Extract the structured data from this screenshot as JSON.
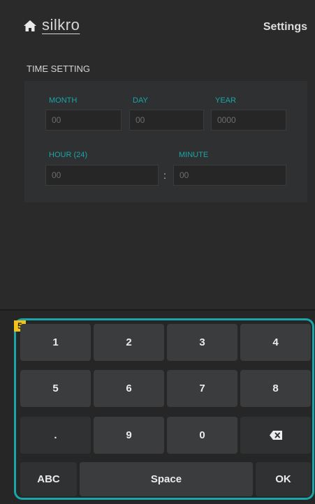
{
  "header": {
    "home_icon": "home-icon",
    "logo": "silkro",
    "settings_label": "Settings"
  },
  "time_setting": {
    "title": "TIME SETTING",
    "month": {
      "label": "MONTH",
      "placeholder": "00"
    },
    "day": {
      "label": "DAY",
      "placeholder": "00"
    },
    "year": {
      "label": "YEAR",
      "placeholder": "0000"
    },
    "hour": {
      "label": "HOUR (24)",
      "placeholder": "00"
    },
    "minute": {
      "label": "MINUTE",
      "placeholder": "00"
    },
    "separator": ":"
  },
  "keyboard": {
    "badge": "5",
    "keys": {
      "k1": "1",
      "k2": "2",
      "k3": "3",
      "k4": "4",
      "k5": "5",
      "k6": "6",
      "k7": "7",
      "k8": "8",
      "dot": ".",
      "k9": "9",
      "k0": "0",
      "backspace_icon": "backspace-icon",
      "abc": "ABC",
      "space": "Space",
      "ok": "OK"
    }
  },
  "colors": {
    "accent": "#19a7ab",
    "badge": "#f2c21a",
    "background": "#2a2a2b"
  }
}
